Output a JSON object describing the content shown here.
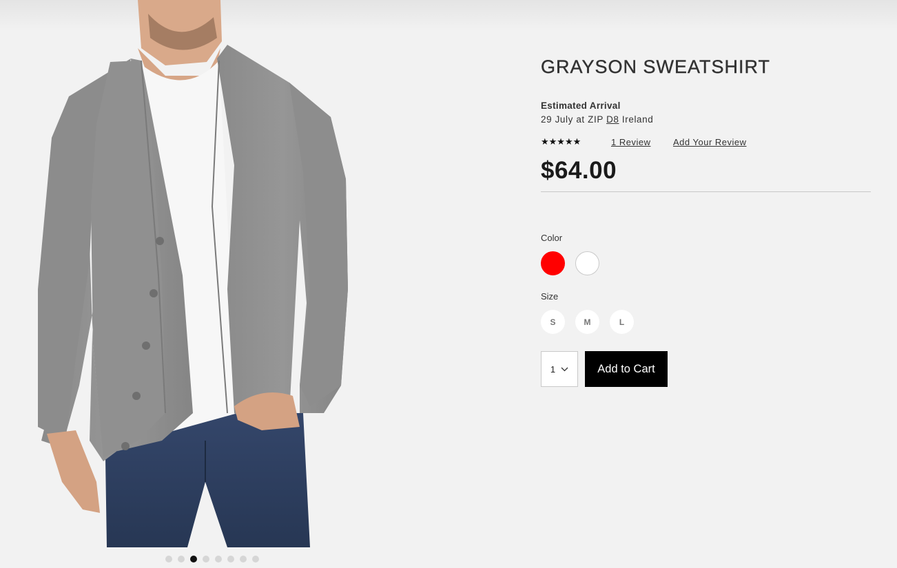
{
  "product": {
    "title": "GRAYSON SWEATSHIRT",
    "arrival_label": "Estimated Arrival",
    "arrival_prefix": "29 July at ZIP",
    "arrival_zip": "D8",
    "arrival_country": "Ireland",
    "stars": "★★★★★",
    "rating_value": 5,
    "review_count_label": "1 Review",
    "add_review_label": "Add Your Review",
    "price": "$64.00"
  },
  "options": {
    "color_label": "Color",
    "colors": [
      {
        "name": "red",
        "hex": "#ff0000"
      },
      {
        "name": "white",
        "hex": "#ffffff"
      }
    ],
    "size_label": "Size",
    "sizes": [
      "S",
      "M",
      "L"
    ]
  },
  "cart": {
    "quantity": "1",
    "add_to_cart_label": "Add to Cart"
  },
  "gallery": {
    "image_count": 8,
    "active_index": 2
  },
  "theme": {
    "background": "#f2f2f2",
    "button_bg": "#000000",
    "sweater_gray": "#8e8e8e",
    "denim": "#2e3e5a"
  }
}
